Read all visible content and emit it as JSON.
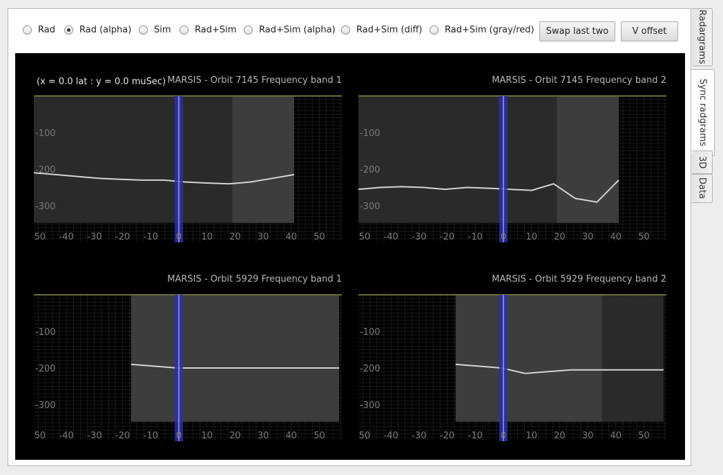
{
  "view_modes": [
    {
      "label": "Rad",
      "selected": false
    },
    {
      "label": "Rad (alpha)",
      "selected": true
    },
    {
      "label": "Sim",
      "selected": false
    },
    {
      "label": "Rad+Sim",
      "selected": false
    },
    {
      "label": "Rad+Sim (alpha)",
      "selected": false
    },
    {
      "label": "Rad+Sim (diff)",
      "selected": false
    },
    {
      "label": "Rad+Sim (gray/red)",
      "selected": false
    }
  ],
  "buttons": {
    "swap": "Swap last two",
    "voffset": "V offset"
  },
  "readout": "(x = 0.0  lat : y = 0.0  muSec)",
  "tabs": [
    {
      "label": "Radargrams",
      "active": false
    },
    {
      "label": "Sync radgrams",
      "active": true
    },
    {
      "label": "3D",
      "active": false
    },
    {
      "label": "Data",
      "active": false
    }
  ],
  "colors": {
    "marker": "#2a2fa8",
    "center_line": "#d8d8ff",
    "top_line": "#d7d76a",
    "axis_label": "#7a7a7a"
  },
  "radargrams": [
    {
      "title": "MARSIS - Orbit 7145 Frequency band 1",
      "coverage_x": [
        -53,
        41
      ],
      "bright_x": [
        19,
        41
      ],
      "surface_y": [
        210,
        215,
        220,
        225,
        228,
        230,
        230,
        235,
        238,
        240,
        235,
        225,
        215
      ],
      "y_ticks": [
        "-100",
        "-200",
        "-300"
      ],
      "x_ticks": [
        "-50",
        "-40",
        "-30",
        "-20",
        "-10",
        "0",
        "10",
        "20",
        "30",
        "40",
        "50"
      ]
    },
    {
      "title": "MARSIS - Orbit 7145 Frequency band 2",
      "coverage_x": [
        -53,
        41
      ],
      "bright_x": [
        19,
        41
      ],
      "surface_y": [
        255,
        250,
        248,
        250,
        255,
        250,
        252,
        255,
        258,
        240,
        280,
        290,
        230
      ],
      "y_ticks": [
        "-100",
        "-200",
        "-300"
      ],
      "x_ticks": [
        "-50",
        "-40",
        "-30",
        "-20",
        "-10",
        "0",
        "10",
        "20",
        "30",
        "40",
        "50"
      ]
    },
    {
      "title": "MARSIS - Orbit 5929 Frequency band 1",
      "coverage_x": [
        -17,
        57
      ],
      "bright_x": [
        -17,
        57
      ],
      "surface_y": [
        190,
        195,
        200,
        200,
        200,
        200,
        200,
        200,
        200,
        200
      ],
      "y_ticks": [
        "-100",
        "-200",
        "-300"
      ],
      "x_ticks": [
        "-50",
        "-40",
        "-30",
        "-20",
        "-10",
        "0",
        "10",
        "20",
        "30",
        "40",
        "50"
      ]
    },
    {
      "title": "MARSIS - Orbit 5929 Frequency band 2",
      "coverage_x": [
        -17,
        57
      ],
      "bright_x": [
        -17,
        35
      ],
      "surface_y": [
        190,
        195,
        200,
        215,
        210,
        205,
        205,
        205,
        205,
        205
      ],
      "y_ticks": [
        "-100",
        "-200",
        "-300"
      ],
      "x_ticks": [
        "-50",
        "-40",
        "-30",
        "-20",
        "-10",
        "0",
        "10",
        "20",
        "30",
        "40",
        "50"
      ]
    }
  ]
}
